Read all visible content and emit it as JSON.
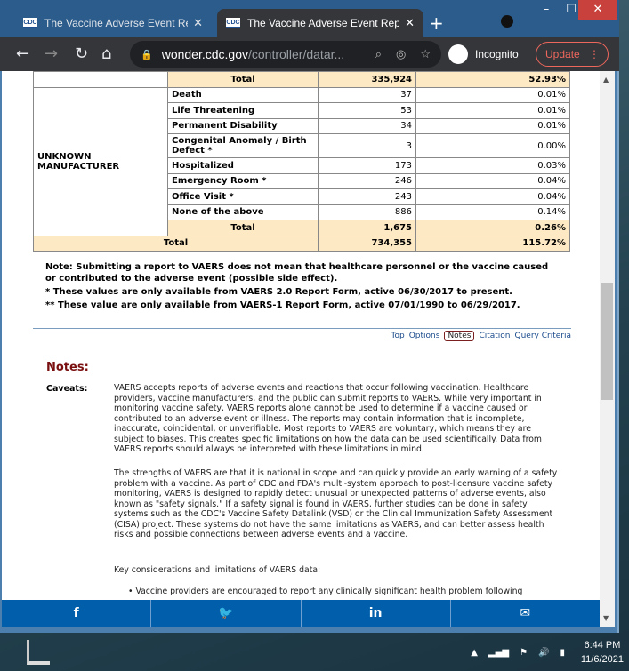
{
  "browser": {
    "tabs": [
      {
        "label": "The Vaccine Adverse Event Rep",
        "active": false
      },
      {
        "label": "The Vaccine Adverse Event Rep",
        "active": true
      }
    ],
    "favicon_text": "CDC",
    "url_host": "wonder.cdc.gov",
    "url_path": "/controller/datar...",
    "profile_label": "Incognito",
    "update_label": "Update"
  },
  "table": {
    "top_total": {
      "label": "Total",
      "count": "335,924",
      "percent": "52.93%"
    },
    "group": "UNKNOWN MANUFACTURER",
    "rows": [
      {
        "label": "Death",
        "count": "37",
        "percent": "0.01%"
      },
      {
        "label": "Life Threatening",
        "count": "53",
        "percent": "0.01%"
      },
      {
        "label": "Permanent Disability",
        "count": "34",
        "percent": "0.01%"
      },
      {
        "label": "Congenital Anomaly / Birth Defect *",
        "count": "3",
        "percent": "0.00%"
      },
      {
        "label": "Hospitalized",
        "count": "173",
        "percent": "0.03%"
      },
      {
        "label": "Emergency Room *",
        "count": "246",
        "percent": "0.04%"
      },
      {
        "label": "Office Visit *",
        "count": "243",
        "percent": "0.04%"
      },
      {
        "label": "None of the above",
        "count": "886",
        "percent": "0.14%"
      }
    ],
    "group_total": {
      "label": "Total",
      "count": "1,675",
      "percent": "0.26%"
    },
    "grand_total": {
      "label": "Total",
      "count": "734,355",
      "percent": "115.72%"
    }
  },
  "notes_block": {
    "line1": "Note: Submitting a report to VAERS does not mean that healthcare personnel or the vaccine caused or contributed to the adverse event (possible side effect).",
    "line2": " * These values are only available from VAERS 2.0 Report Form, active 06/30/2017 to present.",
    "line3": " ** These value are only available from VAERS-1 Report Form, active 07/01/1990 to 06/29/2017."
  },
  "page_links": {
    "top": "Top",
    "options": "Options",
    "notes": "Notes",
    "citation": "Citation",
    "query": "Query Criteria"
  },
  "notes": {
    "heading": "Notes:",
    "caveats_label": "Caveats:",
    "p1": "VAERS accepts reports of adverse events and reactions that occur following vaccination. Healthcare providers, vaccine manufacturers, and the public can submit reports to VAERS. While very important in monitoring vaccine safety, VAERS reports alone cannot be used to determine if a vaccine caused or contributed to an adverse event or illness. The reports may contain information that is incomplete, inaccurate, coincidental, or unverifiable. Most reports to VAERS are voluntary, which means they are subject to biases. This creates specific limitations on how the data can be used scientifically. Data from VAERS reports should always be interpreted with these limitations in mind.",
    "p2": "The strengths of VAERS are that it is national in scope and can quickly provide an early warning of a safety problem with a vaccine. As part of CDC and FDA's multi-system approach to post-licensure vaccine safety monitoring, VAERS is designed to rapidly detect unusual or unexpected patterns of adverse events, also known as \"safety signals.\" If a safety signal is found in VAERS, further studies can be done in safety systems such as the CDC's Vaccine Safety Datalink (VSD) or the Clinical Immunization Safety Assessment (CISA) project. These systems do not have the same limitations as VAERS, and can better assess health risks and possible connections between adverse events and a vaccine.",
    "p3": "Key considerations and limitations of VAERS data:",
    "bullet1": "Vaccine providers are encouraged to report any clinically significant health problem following"
  },
  "social": {
    "facebook": "f",
    "twitter": "🐦",
    "linkedin": "in",
    "email": "✉"
  },
  "taskbar": {
    "time": "6:44 PM",
    "date": "11/6/2021"
  },
  "colors": {
    "total_row": "#fde9c4",
    "social_bar": "#005eaa",
    "notes_heading": "#7a1010",
    "update": "#ee675c"
  }
}
